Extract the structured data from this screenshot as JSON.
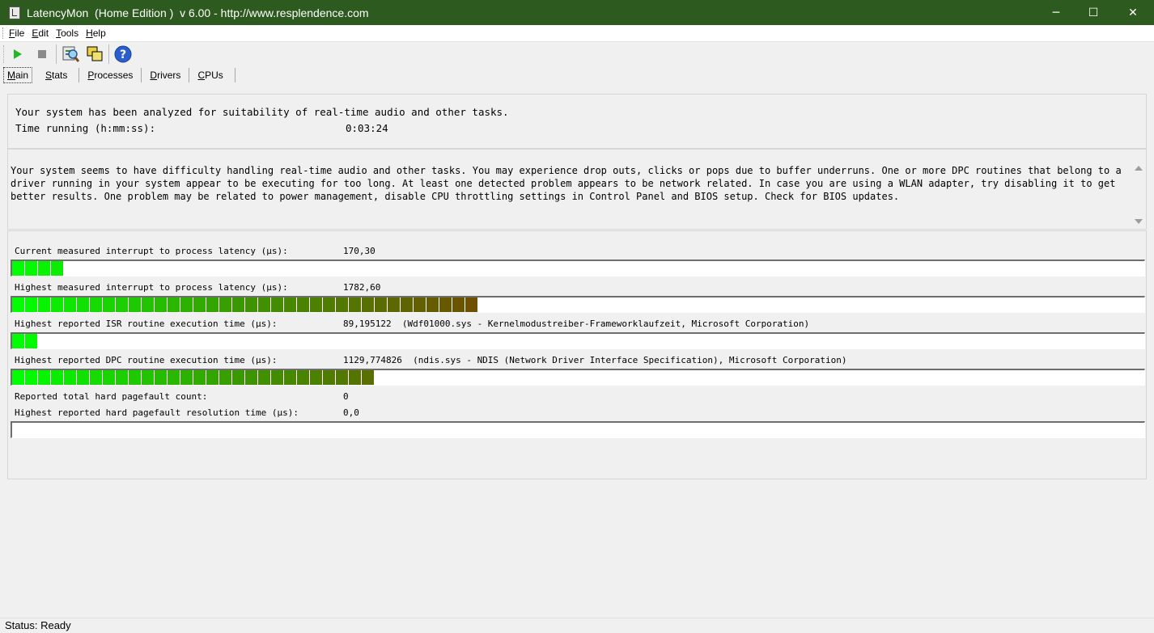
{
  "window": {
    "title": "LatencyMon  (Home Edition )  v 6.00 - http://www.resplendence.com",
    "minimize": "─",
    "maximize": "☐",
    "close": "✕"
  },
  "menu": [
    {
      "u": "F",
      "rest": "ile"
    },
    {
      "u": "E",
      "rest": "dit"
    },
    {
      "u": "T",
      "rest": "ools"
    },
    {
      "u": "H",
      "rest": "elp"
    }
  ],
  "toolbar": {
    "icons": [
      "start-icon",
      "stop-icon",
      "drivers-analyze-icon",
      "windows-icon",
      "help-icon"
    ]
  },
  "tabs": [
    {
      "u": "M",
      "rest": "ain",
      "active": true
    },
    {
      "u": "S",
      "rest": "tats"
    },
    {
      "u": "P",
      "rest": "rocesses"
    },
    {
      "u": "D",
      "rest": "rivers"
    },
    {
      "u": "C",
      "rest": "PUs"
    }
  ],
  "summary": {
    "line1": "Your system has been analyzed for suitability of real-time audio and other tasks.",
    "time_label": "Time running (h:mm:ss):",
    "time_value": "0:03:24"
  },
  "advice": "Your system seems to have difficulty handling real-time audio and other tasks. You may experience drop outs, clicks or pops due to buffer underruns. One or more DPC routines that belong to a driver running in your system appear to be executing for too long. At least one detected problem appears to be network related. In case you are using a WLAN adapter, try disabling it to get better results. One problem may be related to power management, disable CPU throttling settings in Control Panel and BIOS setup. Check for BIOS updates.",
  "metrics": {
    "current_latency": {
      "label": "Current measured interrupt to process latency (µs):",
      "value": "170,30",
      "bar_segments": 4
    },
    "highest_latency": {
      "label": "Highest measured interrupt to process latency (µs):",
      "value": "1782,60",
      "bar_segments": 36
    },
    "isr": {
      "label": "Highest reported ISR routine execution time (µs):",
      "value": "89,195122  (Wdf01000.sys - Kernelmodustreiber-Frameworklaufzeit, Microsoft Corporation)",
      "bar_segments": 2
    },
    "dpc": {
      "label": "Highest reported DPC routine execution time (µs):",
      "value": "1129,774826  (ndis.sys - NDIS (Network Driver Interface Specification), Microsoft Corporation)",
      "bar_segments": 28
    },
    "pagefault_count": {
      "label": "Reported total hard pagefault count:",
      "value": "0"
    },
    "pagefault_time": {
      "label": "Highest reported hard pagefault resolution time (µs):",
      "value": "0,0",
      "bar_segments": 0
    }
  },
  "status": "Status: Ready"
}
